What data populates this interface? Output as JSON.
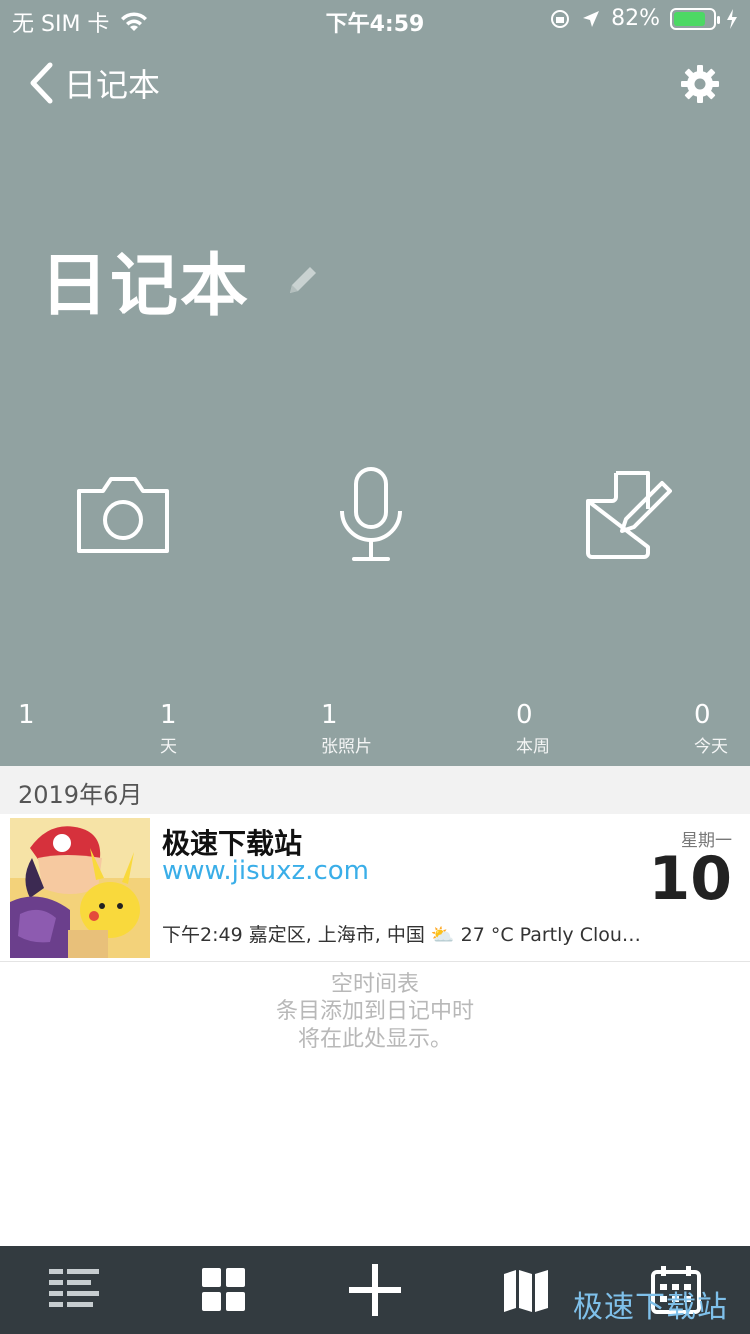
{
  "status_bar": {
    "carrier": "无 SIM 卡",
    "time": "下午4:59",
    "battery": "82%",
    "battery_level": 0.82
  },
  "nav": {
    "back_label": "日记本"
  },
  "journal": {
    "title": "日记本"
  },
  "stats": [
    {
      "value": "1",
      "label": ""
    },
    {
      "value": "1",
      "label": "天"
    },
    {
      "value": "1",
      "label": "张照片"
    },
    {
      "value": "0",
      "label": "本周"
    },
    {
      "value": "0",
      "label": "今天"
    }
  ],
  "month_header": "2019年6月",
  "entry": {
    "title": "极速下载站",
    "link": "www.jisuxz.com",
    "meta": "下午2:49 嘉定区, 上海市, 中国 ⛅ 27 °C Partly Clou…",
    "weekday": "星期一",
    "day": "10"
  },
  "empty_state": {
    "heading": "空时间表",
    "line1": "条目添加到日记中时",
    "line2": "将在此处显示。"
  },
  "watermark": "极速下载站",
  "colors": {
    "header_bg": "#91a2a1",
    "tabbar_bg": "#333b40",
    "link": "#3aaee8",
    "battery": "#4cd964"
  }
}
